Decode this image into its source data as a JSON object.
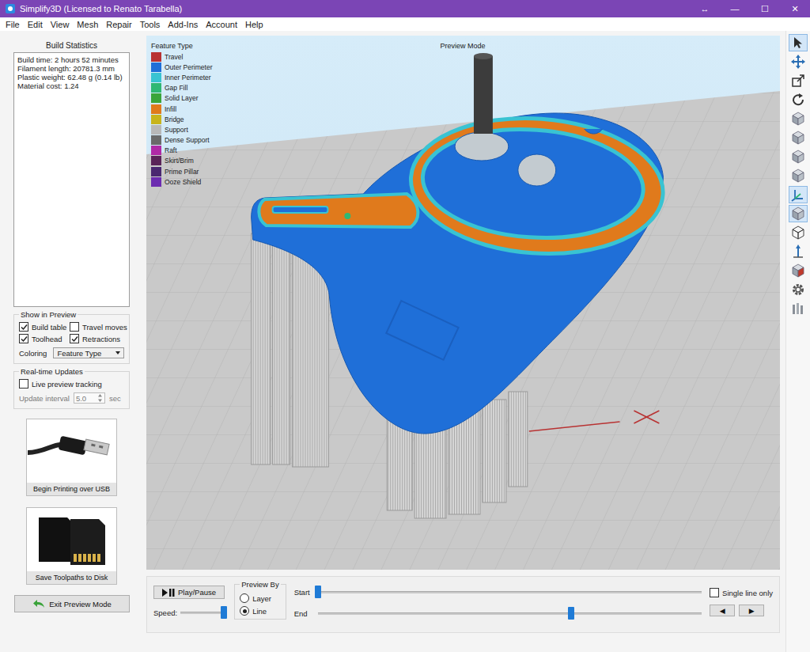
{
  "window": {
    "title": "Simplify3D (Licensed to Renato Tarabella)",
    "controls": [
      "↔",
      "—",
      "☐",
      "✕"
    ]
  },
  "menu": [
    "File",
    "Edit",
    "View",
    "Mesh",
    "Repair",
    "Tools",
    "Add-Ins",
    "Account",
    "Help"
  ],
  "build_statistics": {
    "title": "Build Statistics",
    "lines": [
      "Build time: 2 hours 52 minutes",
      "Filament length: 20781.3 mm",
      "Plastic weight: 62.48 g (0.14 lb)",
      "Material cost: 1.24"
    ]
  },
  "show_in_preview": {
    "title": "Show in Preview",
    "options": [
      {
        "label": "Build table",
        "checked": true
      },
      {
        "label": "Travel moves",
        "checked": false
      },
      {
        "label": "Toolhead",
        "checked": true
      },
      {
        "label": "Retractions",
        "checked": true
      }
    ],
    "coloring": {
      "label": "Coloring",
      "value": "Feature Type"
    }
  },
  "realtime_updates": {
    "title": "Real-time Updates",
    "live_preview": {
      "label": "Live preview tracking",
      "checked": false
    },
    "interval": {
      "label": "Update interval",
      "value": "5.0",
      "unit": "sec",
      "disabled": true
    }
  },
  "actions": [
    {
      "label": "Begin Printing over USB",
      "kind": "usb"
    },
    {
      "label": "Save Toolpaths to Disk",
      "kind": "sd"
    }
  ],
  "exit_button": {
    "label": "Exit Preview Mode"
  },
  "viewport": {
    "mode_label": "Preview Mode",
    "legend": {
      "title": "Feature Type",
      "items": [
        {
          "label": "Travel",
          "color": "#b83232"
        },
        {
          "label": "Outer Perimeter",
          "color": "#1f6fd8"
        },
        {
          "label": "Inner Perimeter",
          "color": "#39c3d2"
        },
        {
          "label": "Gap Fill",
          "color": "#2fb874"
        },
        {
          "label": "Solid Layer",
          "color": "#3aa53a"
        },
        {
          "label": "Infill",
          "color": "#e07a1c"
        },
        {
          "label": "Bridge",
          "color": "#c8b41c"
        },
        {
          "label": "Support",
          "color": "#b8b8b8"
        },
        {
          "label": "Dense Support",
          "color": "#6a6a6a"
        },
        {
          "label": "Raft",
          "color": "#b02aa6"
        },
        {
          "label": "Skirt/Brim",
          "color": "#5a2458"
        },
        {
          "label": "Prime Pillar",
          "color": "#4a2870"
        },
        {
          "label": "Ooze Shield",
          "color": "#6c2cb0"
        }
      ]
    }
  },
  "toolbar": [
    {
      "selected": true
    },
    {
      "selected": false
    },
    {
      "selected": false
    },
    {
      "selected": false
    },
    {
      "selected": false
    },
    {
      "selected": false
    },
    {
      "selected": false
    },
    {
      "selected": false
    },
    {
      "selected": true
    },
    {
      "selected": true
    },
    {
      "selected": false
    },
    {
      "selected": false
    },
    {
      "selected": false
    },
    {
      "selected": false
    },
    {
      "selected": false
    }
  ],
  "playback": {
    "play_label": "Play/Pause",
    "speed": {
      "label": "Speed:",
      "level": 0.95
    },
    "preview_by": {
      "title": "Preview By",
      "options": [
        {
          "label": "Layer",
          "selected": false
        },
        {
          "label": "Line",
          "selected": true
        }
      ]
    },
    "start": {
      "label": "Start",
      "level": 0.0
    },
    "end": {
      "label": "End",
      "level": 0.66
    },
    "single_line": {
      "label": "Single line only",
      "checked": false
    },
    "step_buttons": [
      "◀",
      "▶"
    ]
  }
}
